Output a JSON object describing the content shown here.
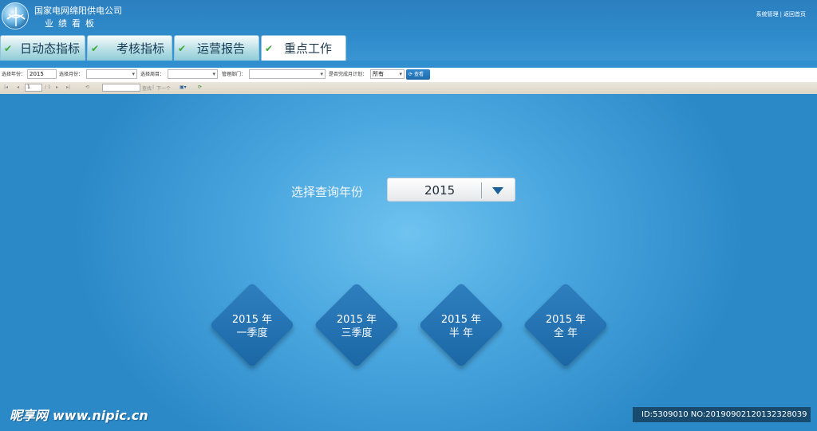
{
  "header": {
    "company": "国家电网绵阳供电公司",
    "subtitle": "业绩看板",
    "links": [
      "系统管理",
      "返回首页"
    ],
    "separator": "|"
  },
  "tabs": [
    {
      "label": "日动态指标",
      "active": false
    },
    {
      "label": "考核指标",
      "active": false
    },
    {
      "label": "运营报告",
      "active": false
    },
    {
      "label": "重点工作",
      "active": true
    }
  ],
  "filters": {
    "year_label": "选择年份：",
    "year_value": "2015",
    "month_label": "选择月份：",
    "month_value": "",
    "cycle_label": "选择周目：",
    "cycle_value": "",
    "dept_label": "管理部门：",
    "dept_value": "",
    "plan_label": "是否完成月计划：",
    "plan_value": "所有",
    "view_button": "查看"
  },
  "pager": {
    "page_value": "1",
    "page_total": "/ 1",
    "search_value": "",
    "find_label": "查找",
    "next_label": "下一个"
  },
  "main": {
    "year_label": "选择查询年份",
    "year_value": "2015",
    "cards": [
      {
        "line1": "2015 年",
        "line2": "一季度"
      },
      {
        "line1": "2015 年",
        "line2": "三季度"
      },
      {
        "line1": "2015 年",
        "line2": "半 年"
      },
      {
        "line1": "2015 年",
        "line2": "全 年"
      }
    ]
  },
  "watermark": {
    "brand": "昵享网",
    "site": "www.nipic.cn",
    "id_text": "ID:5309010 NO:20190902120132328039"
  },
  "colors": {
    "header": "#2b7fbf",
    "accent": "#1b67a6",
    "tab_check": "#3ea83a",
    "main_center": "#6ec3ef"
  }
}
